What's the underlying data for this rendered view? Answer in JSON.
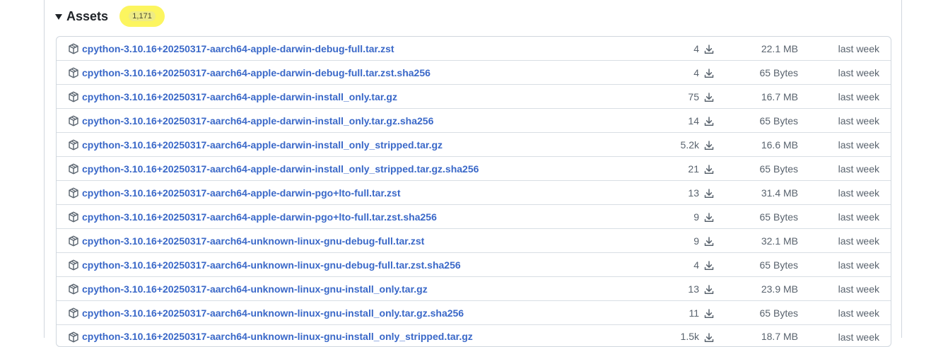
{
  "assets": {
    "title": "Assets",
    "count": "1,171",
    "rows": [
      {
        "name": "cpython-3.10.16+20250317-aarch64-apple-darwin-debug-full.tar.zst",
        "downloads": "4",
        "size": "22.1 MB",
        "date": "last week"
      },
      {
        "name": "cpython-3.10.16+20250317-aarch64-apple-darwin-debug-full.tar.zst.sha256",
        "downloads": "4",
        "size": "65 Bytes",
        "date": "last week"
      },
      {
        "name": "cpython-3.10.16+20250317-aarch64-apple-darwin-install_only.tar.gz",
        "downloads": "75",
        "size": "16.7 MB",
        "date": "last week"
      },
      {
        "name": "cpython-3.10.16+20250317-aarch64-apple-darwin-install_only.tar.gz.sha256",
        "downloads": "14",
        "size": "65 Bytes",
        "date": "last week"
      },
      {
        "name": "cpython-3.10.16+20250317-aarch64-apple-darwin-install_only_stripped.tar.gz",
        "downloads": "5.2k",
        "size": "16.6 MB",
        "date": "last week"
      },
      {
        "name": "cpython-3.10.16+20250317-aarch64-apple-darwin-install_only_stripped.tar.gz.sha256",
        "downloads": "21",
        "size": "65 Bytes",
        "date": "last week"
      },
      {
        "name": "cpython-3.10.16+20250317-aarch64-apple-darwin-pgo+lto-full.tar.zst",
        "downloads": "13",
        "size": "31.4 MB",
        "date": "last week"
      },
      {
        "name": "cpython-3.10.16+20250317-aarch64-apple-darwin-pgo+lto-full.tar.zst.sha256",
        "downloads": "9",
        "size": "65 Bytes",
        "date": "last week"
      },
      {
        "name": "cpython-3.10.16+20250317-aarch64-unknown-linux-gnu-debug-full.tar.zst",
        "downloads": "9",
        "size": "32.1 MB",
        "date": "last week"
      },
      {
        "name": "cpython-3.10.16+20250317-aarch64-unknown-linux-gnu-debug-full.tar.zst.sha256",
        "downloads": "4",
        "size": "65 Bytes",
        "date": "last week"
      },
      {
        "name": "cpython-3.10.16+20250317-aarch64-unknown-linux-gnu-install_only.tar.gz",
        "downloads": "13",
        "size": "23.9 MB",
        "date": "last week"
      },
      {
        "name": "cpython-3.10.16+20250317-aarch64-unknown-linux-gnu-install_only.tar.gz.sha256",
        "downloads": "11",
        "size": "65 Bytes",
        "date": "last week"
      },
      {
        "name": "cpython-3.10.16+20250317-aarch64-unknown-linux-gnu-install_only_stripped.tar.gz",
        "downloads": "1.5k",
        "size": "18.7 MB",
        "date": "last week"
      }
    ]
  },
  "icons": {
    "caret": "triangle-down-icon",
    "package": "package-icon",
    "download": "download-icon"
  },
  "colors": {
    "link": "#3a68c8",
    "muted": "#59636e",
    "highlight": "#fcf55f",
    "border": "#d0d7de"
  }
}
